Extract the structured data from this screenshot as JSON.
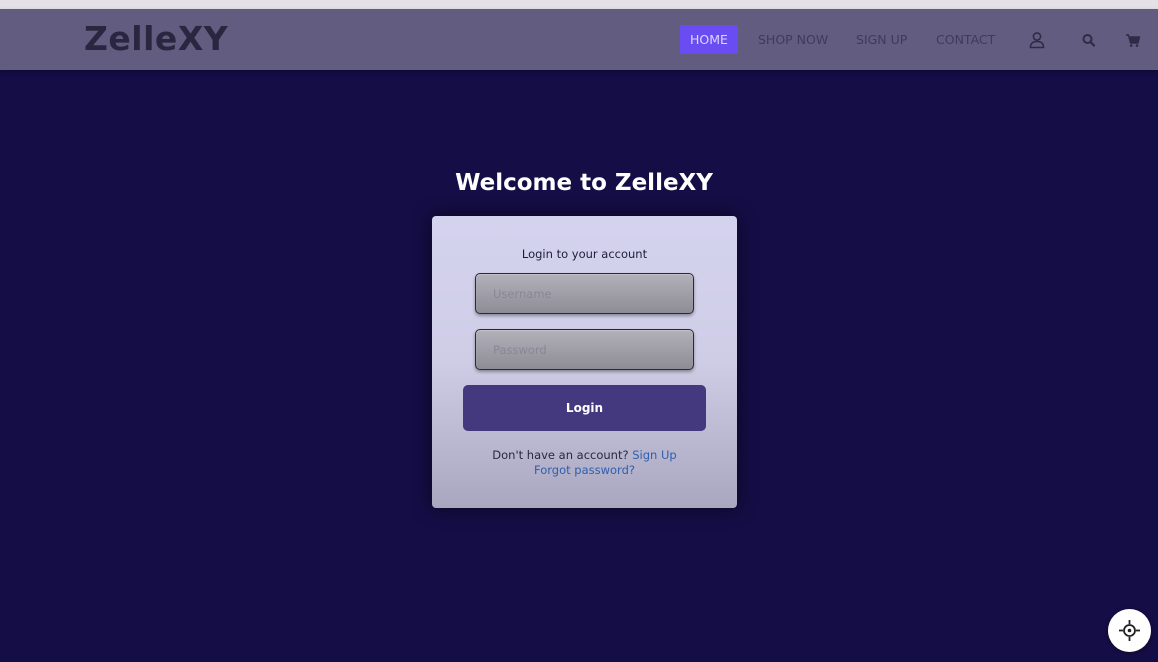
{
  "nav": {
    "logo": "ZelleXY",
    "links": [
      {
        "label": "HOME",
        "active": true
      },
      {
        "label": "SHOP NOW",
        "active": false
      },
      {
        "label": "SIGN UP",
        "active": false
      },
      {
        "label": "CONTACT",
        "active": false
      }
    ],
    "icons": [
      "user-icon",
      "search-icon",
      "cart-icon"
    ]
  },
  "main": {
    "title": "Welcome to ZelleXY"
  },
  "login": {
    "heading": "Login to your account",
    "username_placeholder": "Username",
    "password_placeholder": "Password",
    "submit_label": "Login",
    "signup_prompt": "Don't have an account?",
    "signup_link": "Sign Up",
    "forgot_link": "Forgot password?"
  },
  "floating": {
    "icon": "crosshair-icon"
  },
  "colors": {
    "page_bg": "#150d45",
    "navbar_bg": "#625d80",
    "nav_active_bg": "#6a4df2",
    "login_button": "#44387e",
    "link": "#2f5fae"
  }
}
